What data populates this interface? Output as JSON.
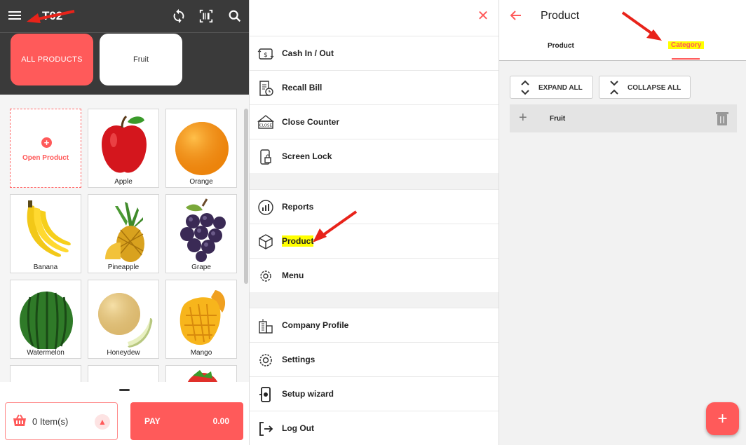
{
  "pos": {
    "title": "T02",
    "categories": [
      "ALL PRODUCTS",
      "Fruit"
    ],
    "open_product": "Open Product",
    "products": [
      "Apple",
      "Orange",
      "Banana",
      "Pineapple",
      "Grape",
      "Watermelon",
      "Honeydew",
      "Mango"
    ],
    "cart_items": "0 Item(s)",
    "pay_label": "PAY",
    "pay_amount": "0.00"
  },
  "menu": {
    "items": [
      {
        "label": "Cash In / Out",
        "icon": "cash-icon"
      },
      {
        "label": "Recall Bill",
        "icon": "recall-bill-icon"
      },
      {
        "label": "Close Counter",
        "icon": "close-counter-icon"
      },
      {
        "label": "Screen Lock",
        "icon": "screen-lock-icon"
      },
      {
        "label": "Reports",
        "icon": "reports-icon"
      },
      {
        "label": "Product",
        "icon": "product-box-icon"
      },
      {
        "label": "Menu",
        "icon": "menu-gear-icon"
      },
      {
        "label": "Company Profile",
        "icon": "company-icon"
      },
      {
        "label": "Settings",
        "icon": "settings-icon"
      },
      {
        "label": "Setup wizard",
        "icon": "setup-wizard-icon"
      },
      {
        "label": "Log Out",
        "icon": "logout-icon"
      }
    ],
    "close_icon": "close-icon"
  },
  "product": {
    "title": "Product",
    "tabs": [
      "Product",
      "Category"
    ],
    "expand_all": "EXPAND ALL",
    "collapse_all": "COLLAPSE ALL",
    "category_rows": [
      "Fruit"
    ]
  },
  "colors": {
    "accent": "#ff5a5a",
    "highlight": "#ffff00",
    "dark_bar": "#3a3a3a"
  }
}
